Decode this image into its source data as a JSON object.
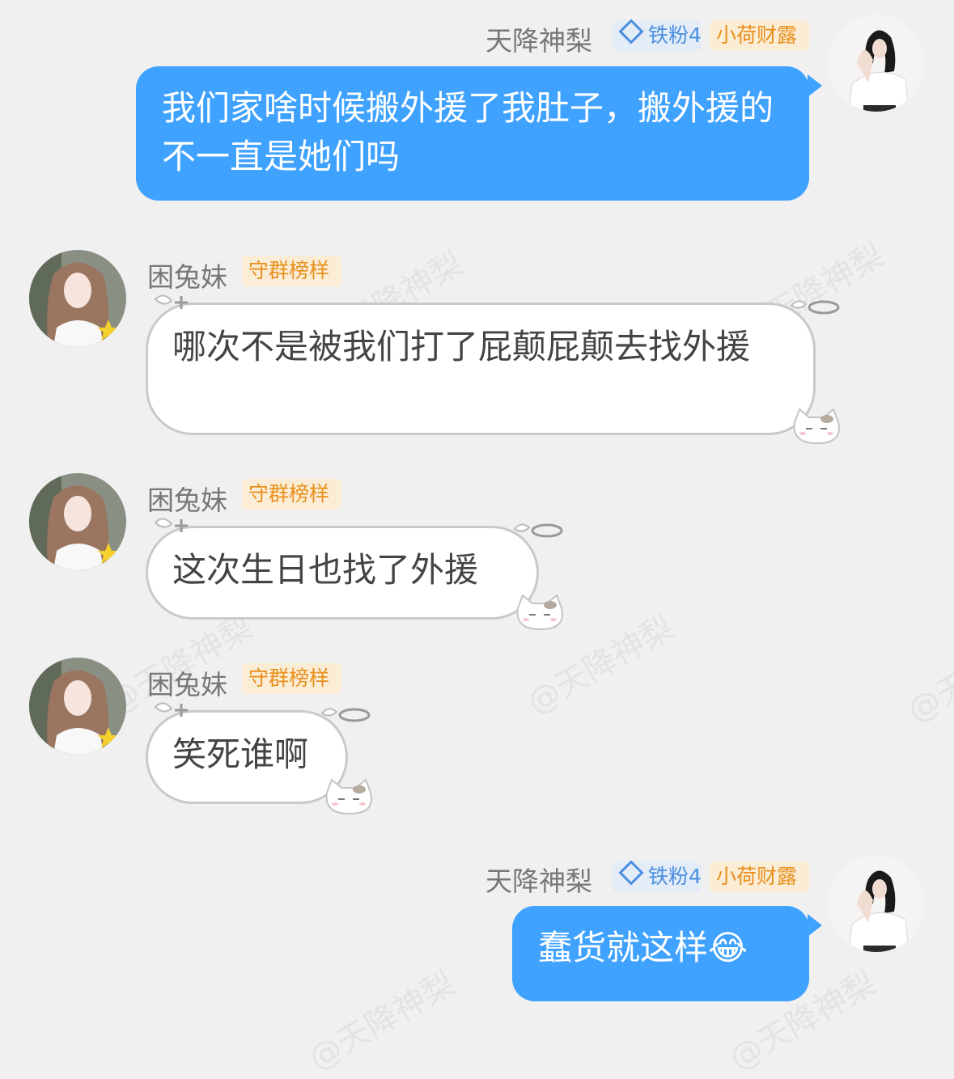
{
  "watermark": "@天降神梨",
  "users": {
    "me": {
      "name": "天降神梨",
      "fan_badge": "铁粉4",
      "title_badge": "小荷财露"
    },
    "other": {
      "name": "困兔妹",
      "title_badge": "守群榜样"
    }
  },
  "messages": [
    {
      "sender": "me",
      "text": "我们家啥时候搬外援了我肚子，搬外援的不一直是她们吗"
    },
    {
      "sender": "other",
      "text": "哪次不是被我们打了屁颠屁颠去找外援"
    },
    {
      "sender": "other",
      "text": "这次生日也找了外援"
    },
    {
      "sender": "other",
      "text": "笑死谁啊"
    },
    {
      "sender": "me",
      "text": "蠢货就这样",
      "emoji": "😂"
    }
  ],
  "colors": {
    "background": "#f0f0f0",
    "outgoing_bubble": "#3fa2ff",
    "incoming_bubble": "#ffffff",
    "fan_badge_bg": "#e3ecf7",
    "fan_badge_text": "#4a8fe0",
    "title_badge_bg": "#fbecd6",
    "title_badge_text": "#e8901b"
  },
  "icons": {
    "fan_badge": "diamond-icon",
    "bubble_decor": [
      "angel-wings-icon",
      "halo-icon",
      "cat-face-icon"
    ]
  }
}
